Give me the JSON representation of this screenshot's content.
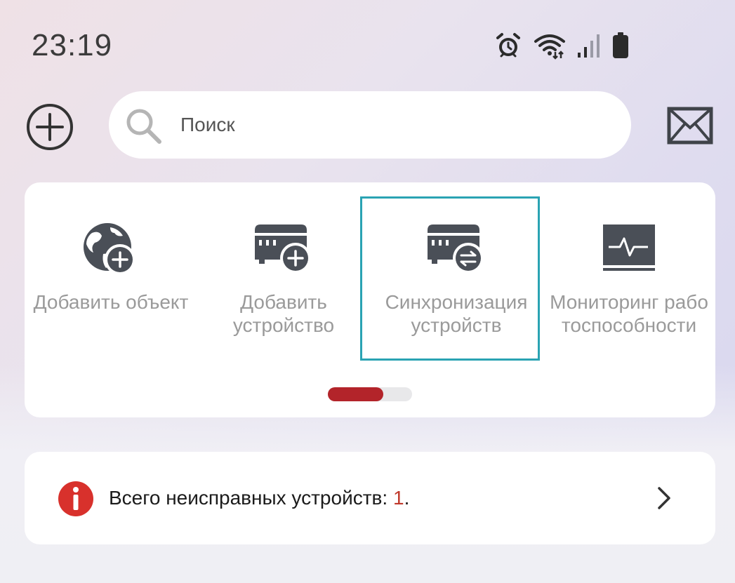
{
  "status_bar": {
    "time": "23:19",
    "icons": [
      "alarm-icon",
      "wifi-icon",
      "signal-icon",
      "battery-icon"
    ]
  },
  "header": {
    "add_icon": "plus-circle-icon",
    "search": {
      "placeholder": "Поиск",
      "value": "",
      "icon": "search-icon"
    },
    "mail_icon": "mail-icon"
  },
  "quick_actions": {
    "items": [
      {
        "label": "Добавить объект",
        "icon": "globe-add-icon",
        "selected": false
      },
      {
        "label": "Добавить\nустройство",
        "icon": "device-add-icon",
        "selected": false
      },
      {
        "label": "Синхронизация\nустройств",
        "icon": "device-sync-icon",
        "selected": true
      },
      {
        "label": "Мониторинг рабо\nтоспособности",
        "icon": "monitor-health-icon",
        "selected": false
      }
    ],
    "pager": {
      "page": 1,
      "progress": 0.66
    }
  },
  "faults": {
    "text": "Всего неисправных устройств: ",
    "count": "1",
    "suffix": ".",
    "icon": "info-icon"
  },
  "colors": {
    "accent_red": "#b3242a",
    "selection_border": "#2aa3b3",
    "icon_dark": "#4a4f57",
    "label_gray": "#9a9a9a"
  }
}
